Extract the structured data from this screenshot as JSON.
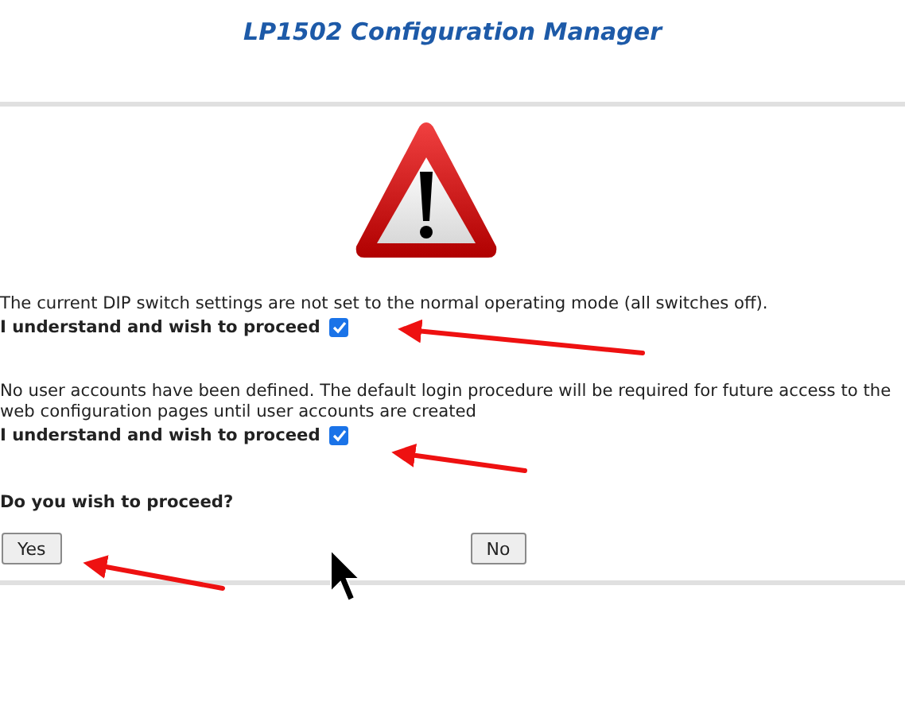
{
  "title": "LP1502 Configuration Manager",
  "warnings": [
    {
      "message": "The current DIP switch settings are not set to the normal operating mode (all switches off).",
      "confirm_label": "I understand and wish to proceed",
      "checked": true
    },
    {
      "message": "No user accounts have been defined. The default login procedure will be required for future access to the web configuration pages until user accounts are created",
      "confirm_label": "I understand and wish to proceed",
      "checked": true
    }
  ],
  "question": "Do you wish to proceed?",
  "buttons": [
    "Yes",
    "No"
  ]
}
